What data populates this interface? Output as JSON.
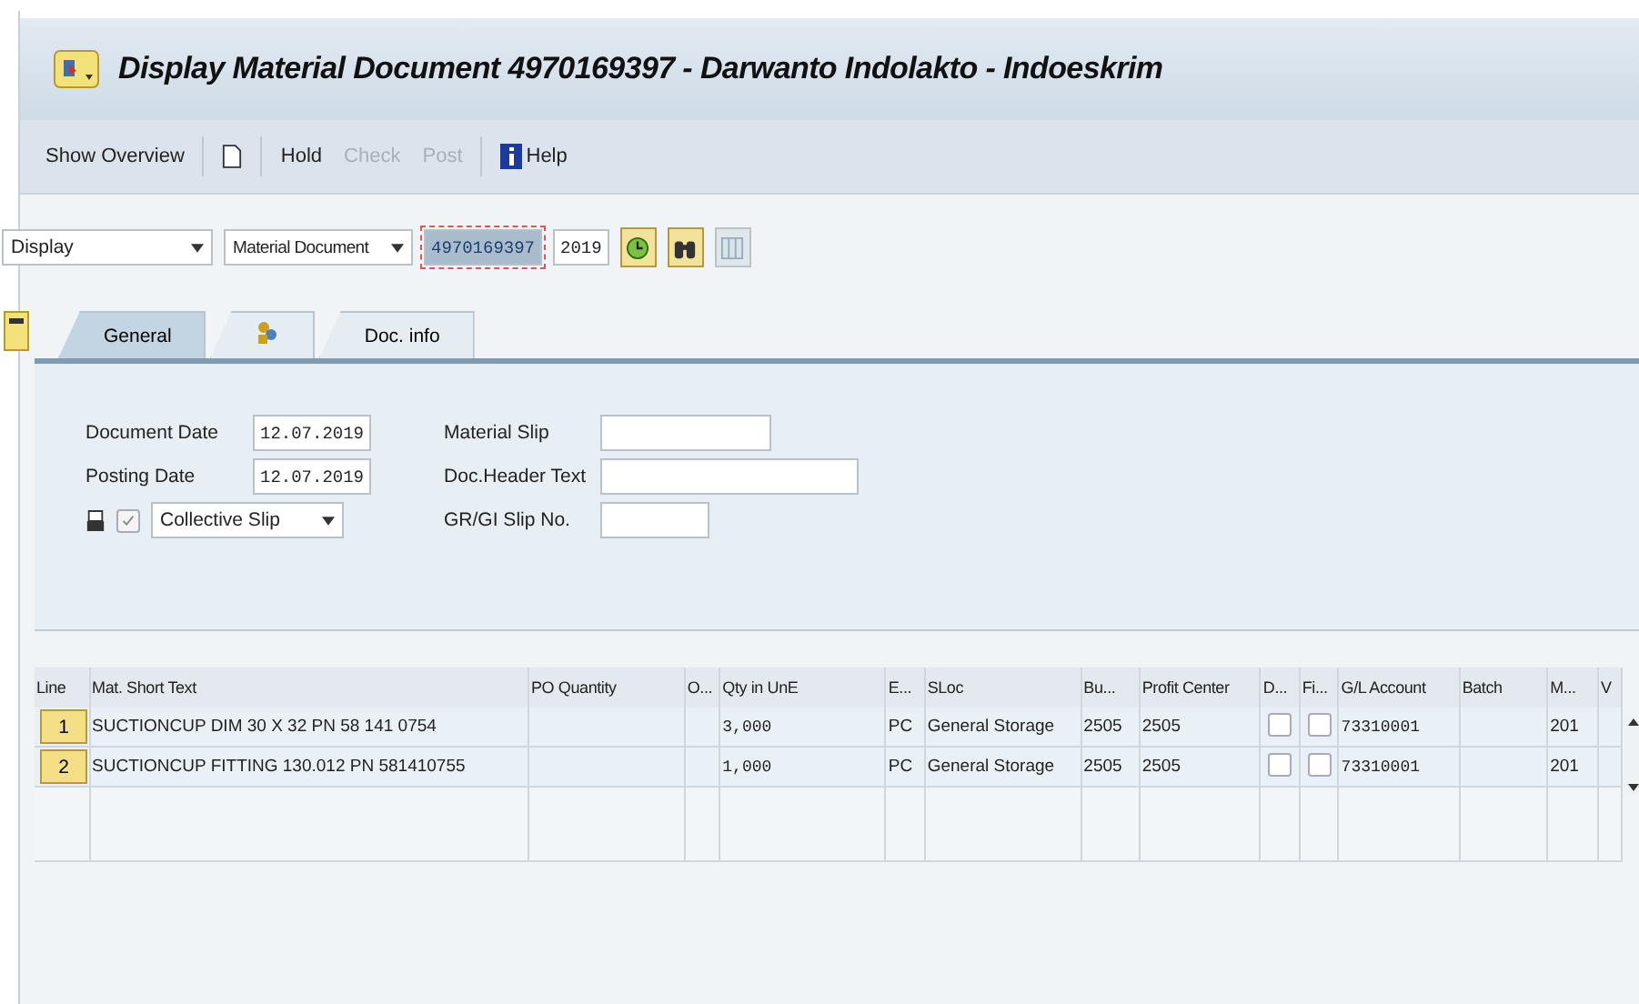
{
  "window": {
    "title": "Display Material Document 4970169397 - Darwanto Indolakto - Indoeskrim"
  },
  "toolbar": [
    {
      "kind": "text",
      "label": "Show Overview",
      "disabled": false
    },
    {
      "kind": "new-doc"
    },
    {
      "kind": "text",
      "label": "Hold",
      "disabled": false
    },
    {
      "kind": "text",
      "label": "Check",
      "disabled": true
    },
    {
      "kind": "text",
      "label": "Post",
      "disabled": true
    },
    {
      "kind": "help",
      "label": "Help",
      "disabled": false
    }
  ],
  "command_row": {
    "action": "Display",
    "object": "Material Document",
    "document_number": "4970169397",
    "year": "2019"
  },
  "tabs": [
    {
      "kind": "text",
      "label": "General",
      "selected": true
    },
    {
      "kind": "icon",
      "selected": false
    },
    {
      "kind": "text",
      "label": "Doc. info",
      "selected": false
    }
  ],
  "header": {
    "left": [
      {
        "label": "Document Date",
        "value": "12.07.2019"
      },
      {
        "label": "Posting Date",
        "value": "12.07.2019"
      }
    ],
    "print": {
      "checked": true,
      "slip": "Collective Slip"
    },
    "right": [
      {
        "label": "Material Slip"
      },
      {
        "label": "Doc.Header Text"
      },
      {
        "label": "GR/GI Slip No."
      }
    ]
  },
  "table": {
    "columns": [
      "Line",
      "Mat. Short Text",
      "PO Quantity",
      "O...",
      "Qty in UnE",
      "E...",
      "SLoc",
      "Bu...",
      "Profit Center",
      "D...",
      "Fi...",
      "G/L Account",
      "Batch",
      "M...",
      "V"
    ],
    "rows": [
      {
        "line": "1",
        "text": "SUCTIONCUP DIM 30 X 32 PN 58 141 0754",
        "qty": "3,000",
        "unit": "PC",
        "sloc": "General Storage",
        "bu": "2505",
        "profit_center": "2505",
        "d": false,
        "fi": false,
        "gl": "73310001",
        "m": "201"
      },
      {
        "line": "2",
        "text": "SUCTIONCUP FITTING 130.012 PN 581410755",
        "qty": "1,000",
        "unit": "PC",
        "sloc": "General Storage",
        "bu": "2505",
        "profit_center": "2505",
        "d": false,
        "fi": false,
        "gl": "73310001",
        "m": "201"
      }
    ]
  }
}
